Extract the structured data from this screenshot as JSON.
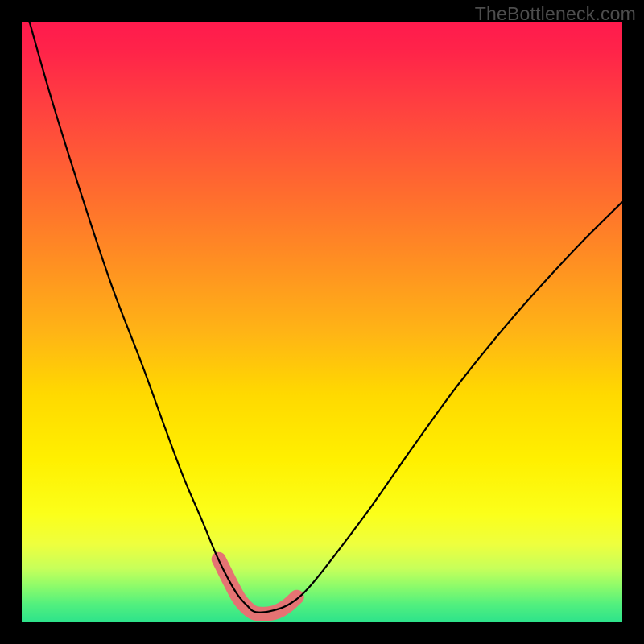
{
  "watermark": "TheBottleneck.com",
  "chart_data": {
    "type": "line",
    "title": "",
    "xlabel": "",
    "ylabel": "",
    "xlim": [
      0,
      100
    ],
    "ylim": [
      0,
      100
    ],
    "series": [
      {
        "name": "bottleneck-curve",
        "stroke": "#000000",
        "stroke_width": 2.2,
        "x": [
          1,
          5,
          10,
          15,
          20,
          24,
          27,
          30,
          32.5,
          34.5,
          36,
          37.5,
          39,
          42,
          45,
          48,
          52,
          58,
          65,
          73,
          82,
          92,
          100
        ],
        "y": [
          101,
          87,
          71,
          56,
          43,
          32,
          24,
          17,
          11,
          7,
          4.5,
          2.8,
          1.7,
          2.0,
          3.3,
          6,
          11,
          19,
          29,
          40,
          51,
          62,
          70
        ]
      },
      {
        "name": "highlight-segment",
        "stroke": "#e57373",
        "stroke_width": 18,
        "linecap": "round",
        "x": [
          32.8,
          34.8,
          36.3,
          38.0,
          39.5,
          42.0,
          44.0,
          45.8
        ],
        "y": [
          10.5,
          6.5,
          3.8,
          2.0,
          1.4,
          1.6,
          2.6,
          4.2
        ]
      }
    ],
    "gradient_stops": [
      {
        "offset": 0.0,
        "color": "#ff1a4d"
      },
      {
        "offset": 0.14,
        "color": "#ff4040"
      },
      {
        "offset": 0.4,
        "color": "#ff8f22"
      },
      {
        "offset": 0.62,
        "color": "#ffd900"
      },
      {
        "offset": 0.82,
        "color": "#fbff1a"
      },
      {
        "offset": 0.94,
        "color": "#8dfb6a"
      },
      {
        "offset": 1.0,
        "color": "#2de38b"
      }
    ]
  }
}
